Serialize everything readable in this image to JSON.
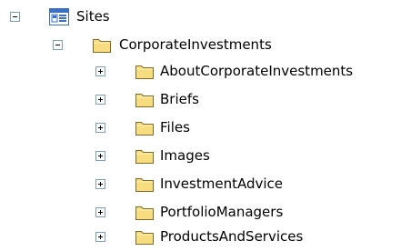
{
  "tree": {
    "root": {
      "label": "Sites",
      "icon": "site-collection-icon",
      "expander": "minus"
    },
    "web": {
      "label": "CorporateInvestments",
      "icon": "folder-icon",
      "expander": "minus"
    },
    "children": [
      {
        "label": "AboutCorporateInvestments",
        "icon": "folder-icon",
        "expander": "plus"
      },
      {
        "label": "Briefs",
        "icon": "folder-icon",
        "expander": "plus"
      },
      {
        "label": "Files",
        "icon": "folder-icon",
        "expander": "plus"
      },
      {
        "label": "Images",
        "icon": "folder-icon",
        "expander": "plus"
      },
      {
        "label": "InvestmentAdvice",
        "icon": "folder-icon",
        "expander": "plus"
      },
      {
        "label": "PortfolioManagers",
        "icon": "folder-icon",
        "expander": "plus"
      },
      {
        "label": "ProductsAndServices",
        "icon": "folder-icon",
        "expander": "plus"
      }
    ]
  },
  "colors": {
    "expander_border": "#7f9db9",
    "folder_fill": "#f7dc80",
    "folder_outline": "#7f6a27",
    "site_icon_blue": "#3a6fc4"
  }
}
